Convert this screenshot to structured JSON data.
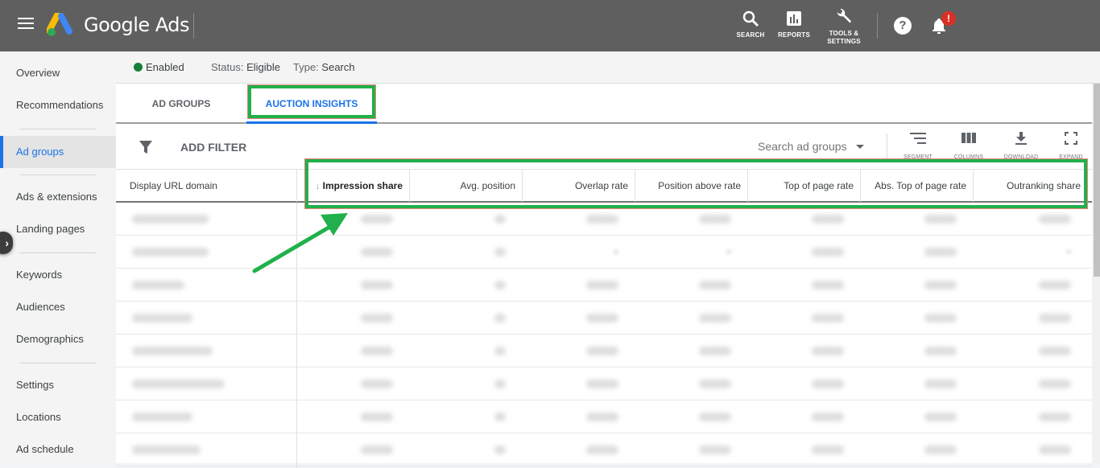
{
  "topbar": {
    "brand": "Google Ads",
    "actions": [
      {
        "name": "search",
        "label": "SEARCH",
        "icon": "search-icon"
      },
      {
        "name": "reports",
        "label": "REPORTS",
        "icon": "bar-chart-icon"
      },
      {
        "name": "tools",
        "label": "TOOLS &",
        "label2": "SETTINGS",
        "icon": "wrench-icon"
      }
    ],
    "help_glyph": "?",
    "notification_badge": "!",
    "colors": {
      "bar": "#5f5f5f",
      "badge": "#d93025"
    }
  },
  "sidebar": {
    "items": [
      {
        "label": "Overview"
      },
      {
        "label": "Recommendations"
      },
      {
        "label": "Ad groups",
        "active": true
      },
      {
        "label": "Ads & extensions"
      },
      {
        "label": "Landing pages"
      },
      {
        "label": "Keywords"
      },
      {
        "label": "Audiences"
      },
      {
        "label": "Demographics"
      },
      {
        "label": "Settings"
      },
      {
        "label": "Locations"
      },
      {
        "label": "Ad schedule"
      }
    ],
    "collapse_glyph": "›"
  },
  "status": {
    "enabled": "Enabled",
    "status_label": "Status:",
    "status_value": "Eligible",
    "type_label": "Type:",
    "type_value": "Search",
    "enabled_color": "#188038"
  },
  "tabs": [
    {
      "label": "AD GROUPS",
      "active": false
    },
    {
      "label": "AUCTION INSIGHTS",
      "active": true
    }
  ],
  "toolbar": {
    "add_filter": "ADD FILTER",
    "search_placeholder": "Search ad groups",
    "tools": [
      {
        "label": "SEGMENT",
        "icon": "segment-icon"
      },
      {
        "label": "COLUMNS",
        "icon": "columns-icon"
      },
      {
        "label": "DOWNLOAD",
        "icon": "download-icon"
      },
      {
        "label": "EXPAND",
        "icon": "expand-icon"
      }
    ]
  },
  "table": {
    "columns": [
      {
        "label": "Display URL domain"
      },
      {
        "label": "Impression share",
        "sorted": "descending",
        "sort_glyph": "↓"
      },
      {
        "label": "Avg. position"
      },
      {
        "label": "Overlap rate"
      },
      {
        "label": "Position above rate"
      },
      {
        "label": "Top of page rate"
      },
      {
        "label": "Abs. Top of page rate"
      },
      {
        "label": "Outranking share"
      }
    ],
    "rows_note": "row values are blurred/redacted in the screenshot",
    "row_count_visible": 8
  },
  "annotation": {
    "highlight_color": "#21b04b"
  }
}
